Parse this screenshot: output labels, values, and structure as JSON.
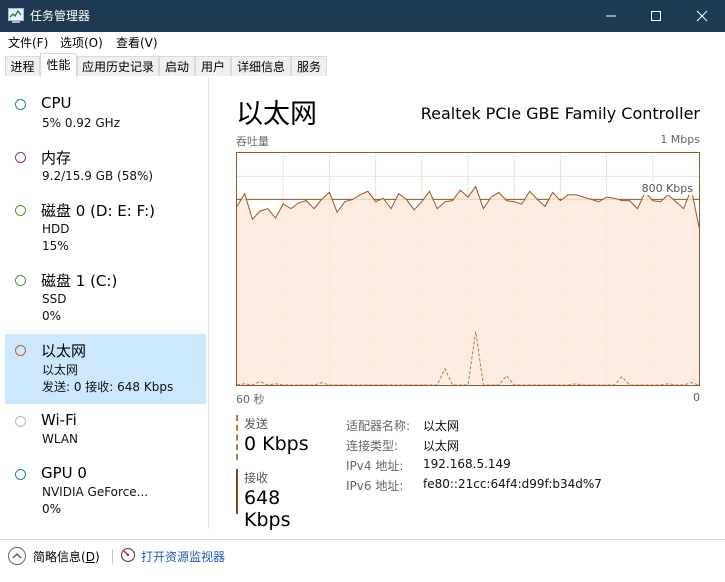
{
  "window": {
    "title": "任务管理器",
    "accent": "#1d3a52"
  },
  "menu": {
    "file": "文件(F)",
    "options": "选项(O)",
    "view": "查看(V)"
  },
  "tabs": [
    "进程",
    "性能",
    "应用历史记录",
    "启动",
    "用户",
    "详细信息",
    "服务"
  ],
  "active_tab": "性能",
  "sidebar": {
    "items": [
      {
        "name": "CPU",
        "sub1": "5%  0.92 GHz",
        "sub2": "",
        "color": "#1f7fc6"
      },
      {
        "name": "内存",
        "sub1": "9.2/15.9 GB (58%)",
        "sub2": "",
        "color": "#9b2c9b"
      },
      {
        "name": "磁盘 0 (D: E: F:)",
        "sub1": "HDD",
        "sub2": "15%",
        "color": "#4aa01e"
      },
      {
        "name": "磁盘 1 (C:)",
        "sub1": "SSD",
        "sub2": "0%",
        "color": "#4aa01e"
      },
      {
        "name": "以太网",
        "sub1": "以太网",
        "sub2": "发送: 0 接收: 648 Kbps",
        "color": "#b5651d"
      },
      {
        "name": "Wi-Fi",
        "sub1": "WLAN",
        "sub2": "",
        "color": "#b8b8b8"
      },
      {
        "name": "GPU 0",
        "sub1": "NVIDIA GeForce...",
        "sub2": "0%",
        "color": "#1f7fc6"
      }
    ],
    "selected": "以太网"
  },
  "main": {
    "title": "以太网",
    "adapter": "Realtek PCIe GBE Family Controller",
    "graph_label": "吞吐量",
    "graph_max": "1 Mbps",
    "level_label": "800 Kbps",
    "time_left": "60 秒",
    "time_right": "0",
    "send_label": "发送",
    "send_value": "0 Kbps",
    "recv_label": "接收",
    "recv_value": "648 Kbps",
    "props": [
      {
        "label": "适配器名称:",
        "value": "以太网"
      },
      {
        "label": "连接类型:",
        "value": "以太网"
      },
      {
        "label": "IPv4 地址:",
        "value": "192.168.5.149"
      },
      {
        "label": "IPv6 地址:",
        "value": "fe80::21cc:64f4:d99f:b34d%7"
      }
    ]
  },
  "chart_data": {
    "type": "line",
    "ylim": [
      0,
      1000
    ],
    "x": [
      0,
      1,
      2,
      3,
      4,
      5,
      6,
      7,
      8,
      9,
      10,
      11,
      12,
      13,
      14,
      15,
      16,
      17,
      18,
      19,
      20,
      21,
      22,
      23,
      24,
      25,
      26,
      27,
      28,
      29,
      30,
      31,
      32,
      33,
      34,
      35,
      36,
      37,
      38,
      39,
      40,
      41,
      42,
      43,
      44,
      45,
      46,
      47,
      48,
      49,
      50,
      51,
      52,
      53,
      54,
      55,
      56,
      57,
      58,
      59,
      60
    ],
    "series": [
      {
        "values": [
          770,
          825,
          715,
          750,
          760,
          720,
          780,
          760,
          785,
          795,
          760,
          800,
          830,
          745,
          790,
          800,
          820,
          835,
          790,
          805,
          760,
          825,
          800,
          755,
          790,
          835,
          760,
          790,
          795,
          840,
          810,
          855,
          760,
          810,
          830,
          795,
          790,
          780,
          835,
          800,
          770,
          830,
          795,
          820,
          820,
          810,
          800,
          790,
          810,
          805,
          795,
          795,
          760,
          830,
          795,
          790,
          820,
          790,
          760,
          845,
          680
        ]
      },
      {
        "values": [
          0,
          5,
          0,
          15,
          0,
          5,
          0,
          0,
          0,
          0,
          0,
          10,
          0,
          0,
          0,
          0,
          0,
          0,
          0,
          0,
          0,
          0,
          0,
          0,
          0,
          0,
          0,
          70,
          0,
          0,
          0,
          230,
          0,
          0,
          0,
          40,
          0,
          0,
          0,
          0,
          0,
          0,
          0,
          0,
          5,
          0,
          0,
          0,
          0,
          0,
          35,
          0,
          0,
          0,
          0,
          0,
          5,
          0,
          0,
          10,
          0
        ]
      }
    ]
  }
}
